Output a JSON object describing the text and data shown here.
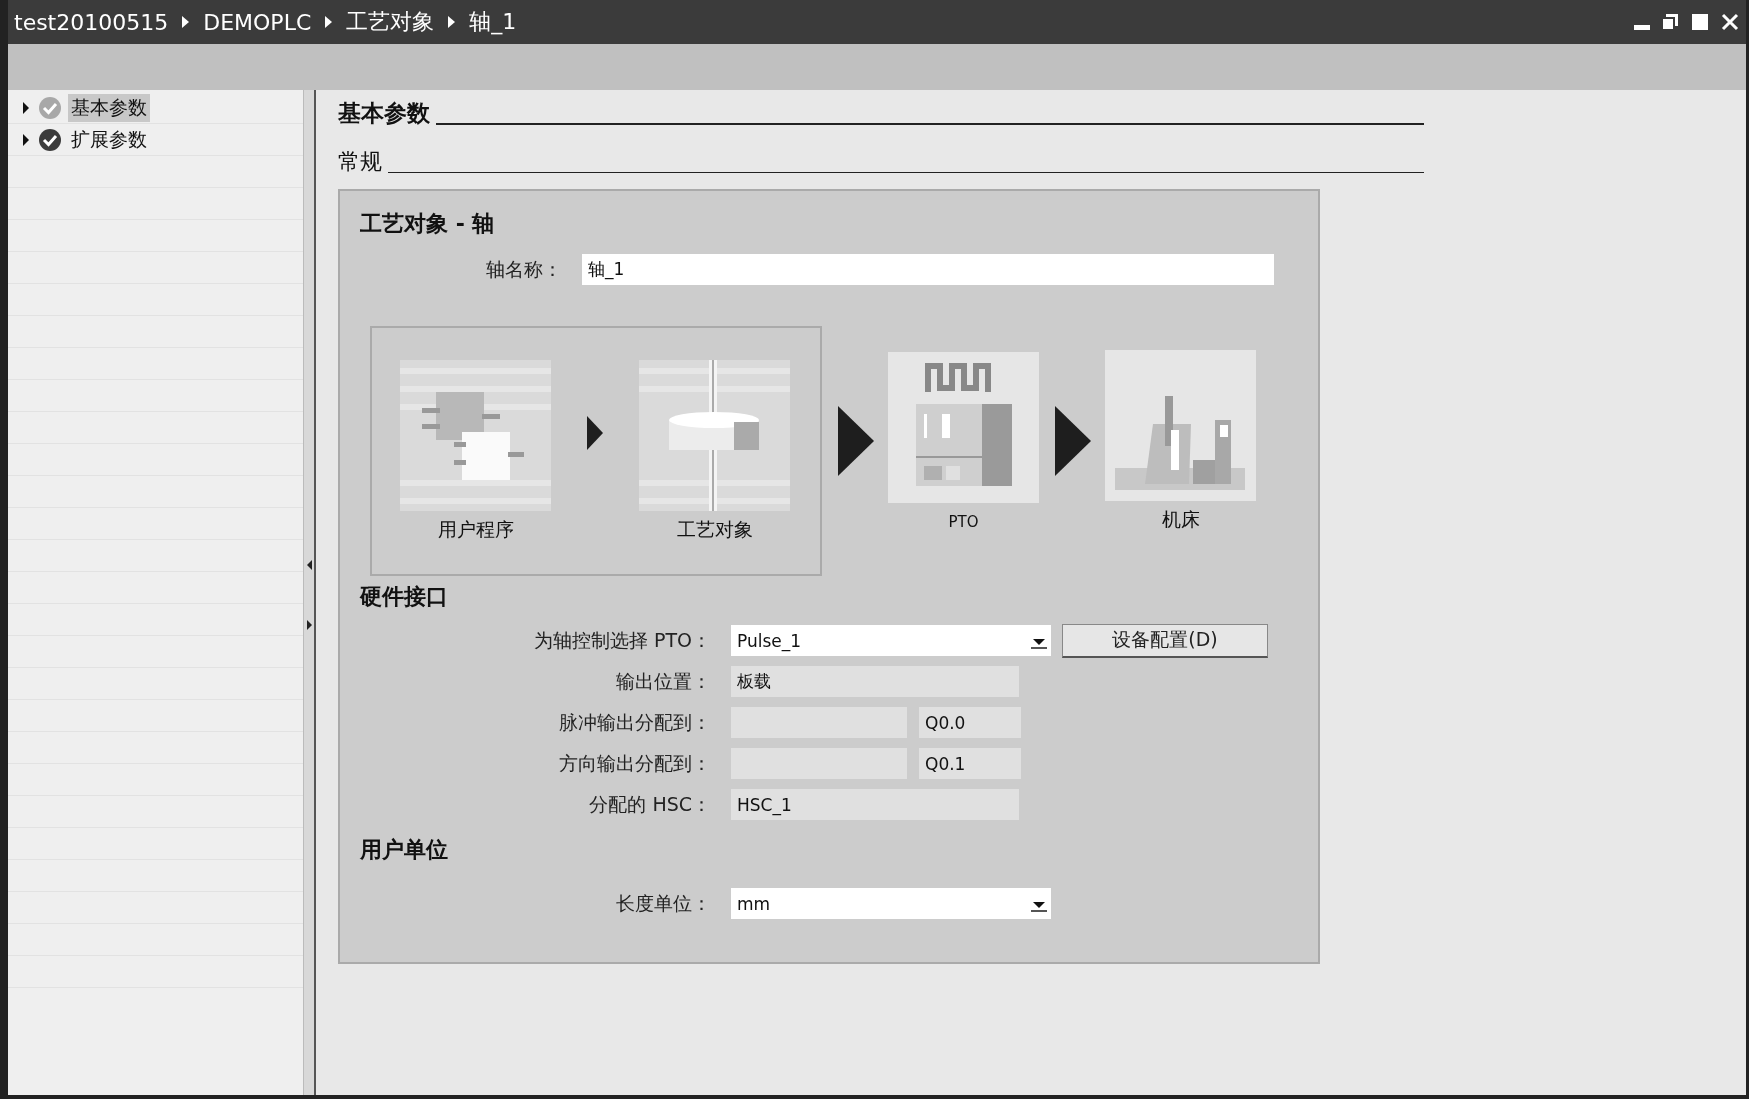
{
  "title_bar": {
    "breadcrumb": [
      "test20100515",
      "DEMOPLC",
      "工艺对象",
      "轴_1"
    ]
  },
  "tree": {
    "items": [
      {
        "label": "基本参数",
        "selected": true,
        "expanded": false
      },
      {
        "label": "扩展参数",
        "selected": false,
        "expanded": false
      }
    ]
  },
  "content": {
    "section_title": "基本参数",
    "subsection_title": "常规",
    "panel": {
      "title": "工艺对象 - 轴",
      "axis_name": {
        "label": "轴名称：",
        "value": "轴_1"
      },
      "diagram": {
        "group": [
          {
            "label": "用户程序",
            "kind": "program"
          },
          {
            "label": "工艺对象",
            "kind": "techobject"
          }
        ],
        "stages": [
          {
            "label": "PTO",
            "kind": "pto"
          },
          {
            "label": "机床",
            "kind": "machine"
          }
        ]
      },
      "hardware": {
        "title": "硬件接口",
        "button": "设备配置(D)",
        "rows": [
          {
            "kind": "dropdown",
            "label": "为轴控制选择 PTO：",
            "value": "Pulse_1"
          },
          {
            "kind": "readonly",
            "label": "输出位置：",
            "value": "板载"
          },
          {
            "kind": "split",
            "label": "脉冲输出分配到：",
            "value": "Q0.0"
          },
          {
            "kind": "split",
            "label": "方向输出分配到：",
            "value": "Q0.1"
          },
          {
            "kind": "readonly",
            "label": "分配的 HSC：",
            "value": "HSC_1"
          }
        ]
      },
      "units": {
        "title": "用户单位",
        "rows": [
          {
            "kind": "dropdown",
            "label": "长度单位：",
            "value": "mm"
          }
        ]
      }
    }
  }
}
